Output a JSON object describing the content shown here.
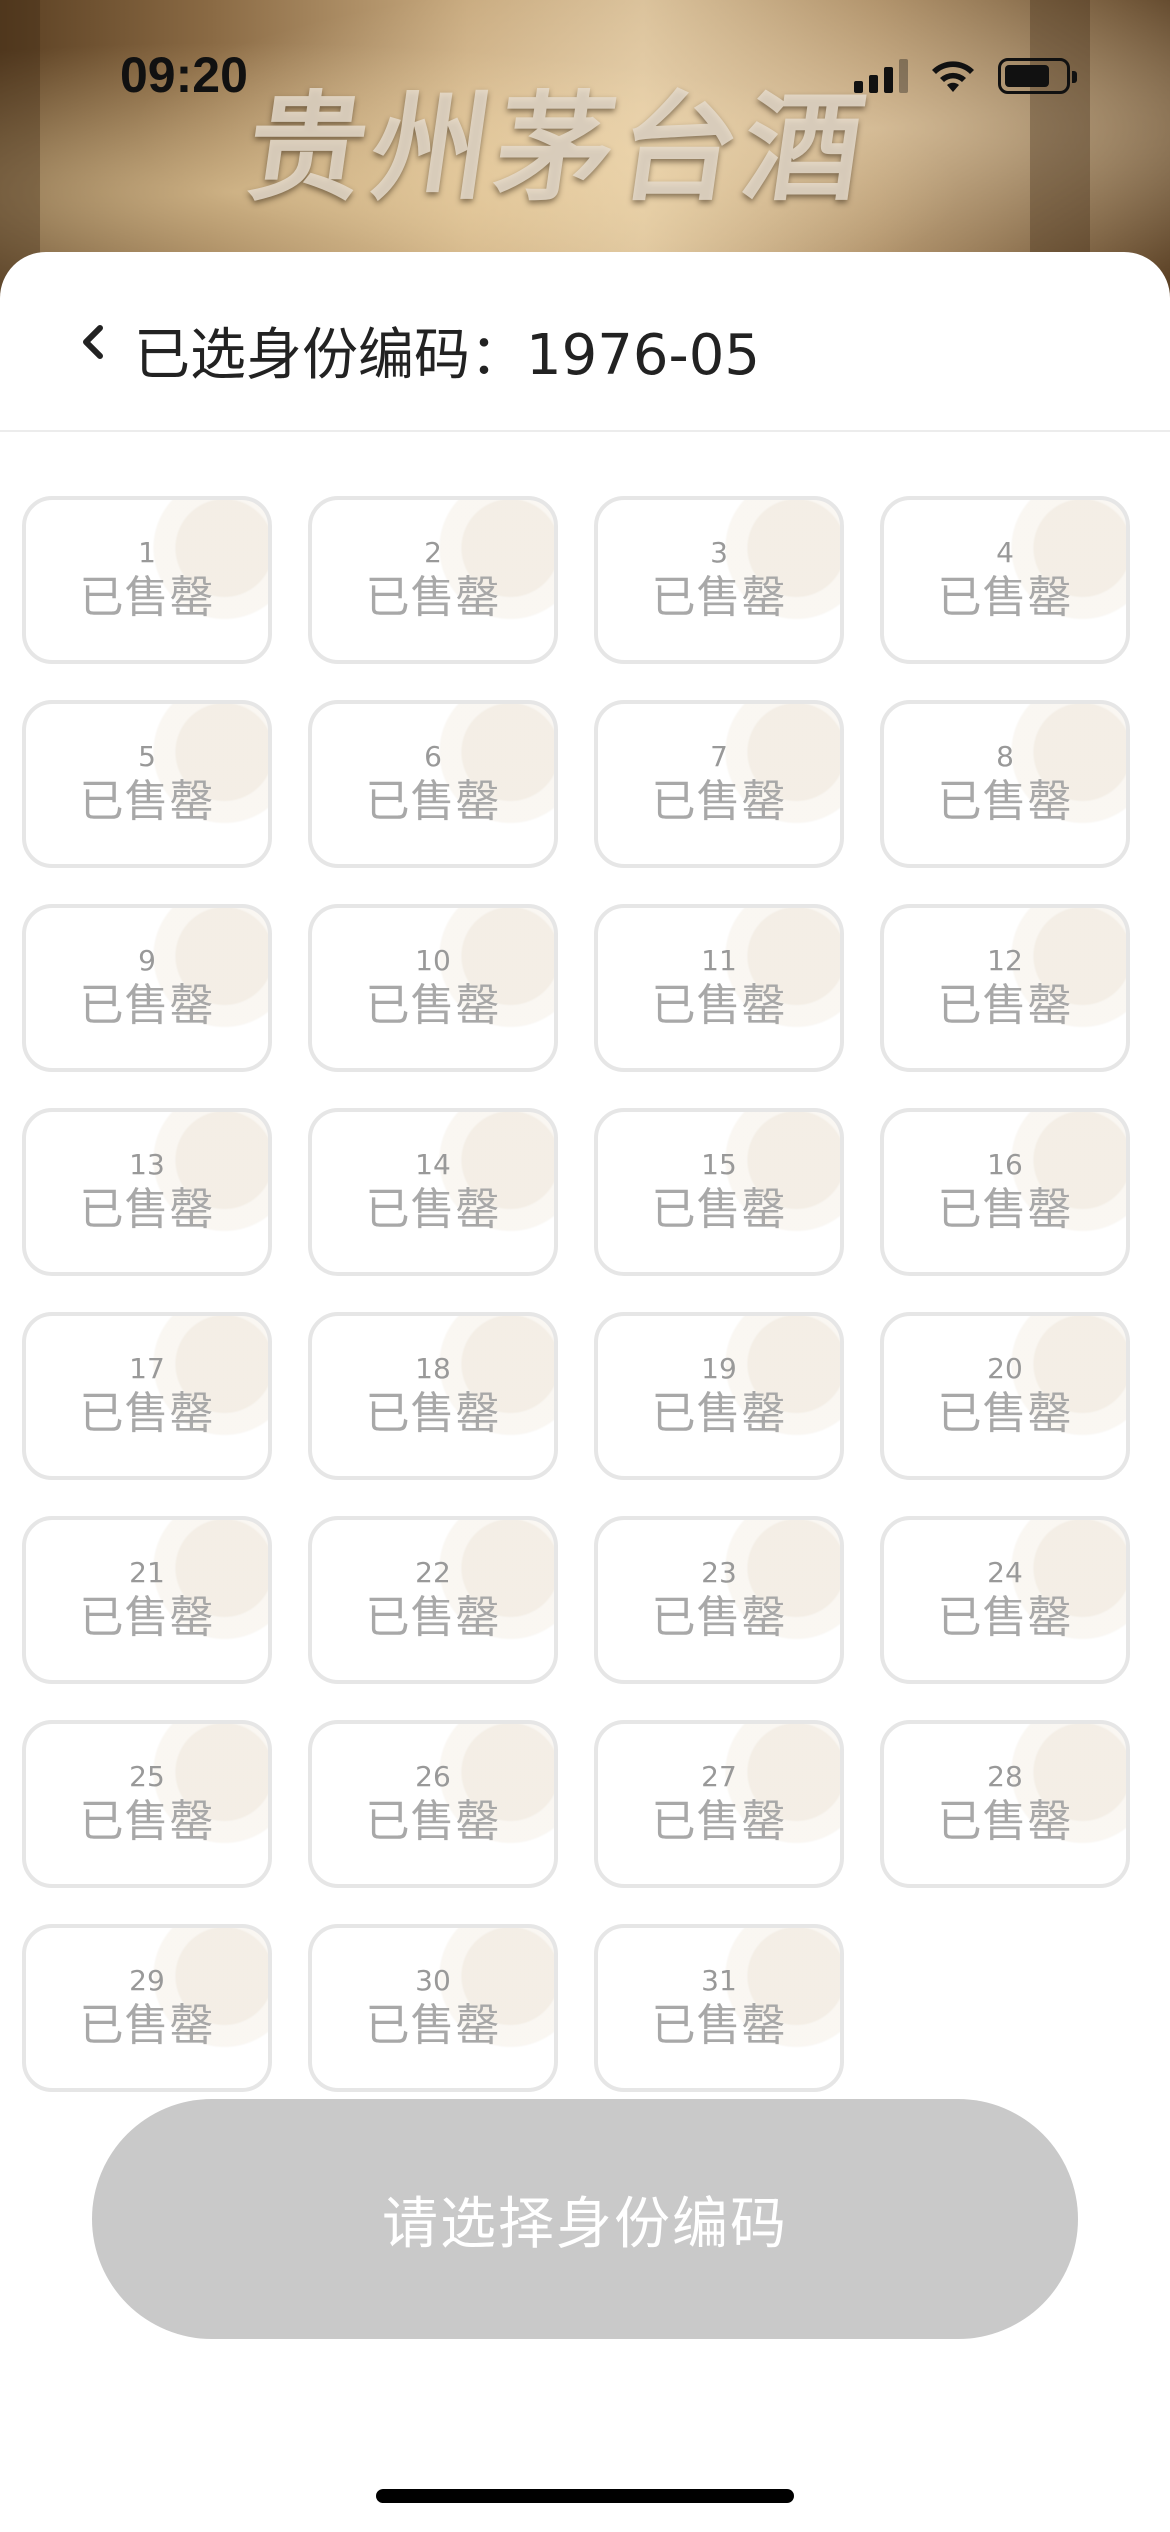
{
  "status_bar": {
    "time": "09:20"
  },
  "hero": {
    "title": "贵州茅台酒"
  },
  "header": {
    "title": "已选身份编码：1976-05"
  },
  "codes": [
    {
      "num": "1",
      "status": "已售罄"
    },
    {
      "num": "2",
      "status": "已售罄"
    },
    {
      "num": "3",
      "status": "已售罄"
    },
    {
      "num": "4",
      "status": "已售罄"
    },
    {
      "num": "5",
      "status": "已售罄"
    },
    {
      "num": "6",
      "status": "已售罄"
    },
    {
      "num": "7",
      "status": "已售罄"
    },
    {
      "num": "8",
      "status": "已售罄"
    },
    {
      "num": "9",
      "status": "已售罄"
    },
    {
      "num": "10",
      "status": "已售罄"
    },
    {
      "num": "11",
      "status": "已售罄"
    },
    {
      "num": "12",
      "status": "已售罄"
    },
    {
      "num": "13",
      "status": "已售罄"
    },
    {
      "num": "14",
      "status": "已售罄"
    },
    {
      "num": "15",
      "status": "已售罄"
    },
    {
      "num": "16",
      "status": "已售罄"
    },
    {
      "num": "17",
      "status": "已售罄"
    },
    {
      "num": "18",
      "status": "已售罄"
    },
    {
      "num": "19",
      "status": "已售罄"
    },
    {
      "num": "20",
      "status": "已售罄"
    },
    {
      "num": "21",
      "status": "已售罄"
    },
    {
      "num": "22",
      "status": "已售罄"
    },
    {
      "num": "23",
      "status": "已售罄"
    },
    {
      "num": "24",
      "status": "已售罄"
    },
    {
      "num": "25",
      "status": "已售罄"
    },
    {
      "num": "26",
      "status": "已售罄"
    },
    {
      "num": "27",
      "status": "已售罄"
    },
    {
      "num": "28",
      "status": "已售罄"
    },
    {
      "num": "29",
      "status": "已售罄"
    },
    {
      "num": "30",
      "status": "已售罄"
    },
    {
      "num": "31",
      "status": "已售罄"
    }
  ],
  "confirm_button": {
    "label": "请选择身份编码",
    "enabled": false
  },
  "colors": {
    "button_disabled": "#c9c9c9",
    "cell_border": "#e6e6e6",
    "sold_out_text": "#a8a8a8"
  }
}
